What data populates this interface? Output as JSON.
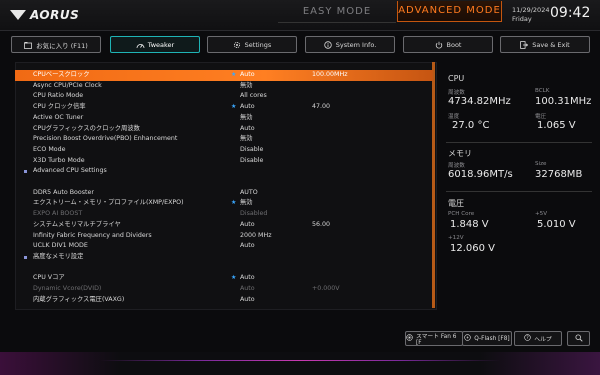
{
  "header": {
    "logo": "AORUS",
    "mode_easy": "EASY MODE",
    "mode_advanced": "ADVANCED MODE",
    "date": "11/29/2024",
    "weekday": "Friday",
    "time": "09:42"
  },
  "tabs": [
    {
      "label": "お気に入り (F11)",
      "icon": "folder-icon"
    },
    {
      "label": "Tweaker",
      "icon": "speedometer-icon"
    },
    {
      "label": "Settings",
      "icon": "gear-icon"
    },
    {
      "label": "System Info.",
      "icon": "info-icon"
    },
    {
      "label": "Boot",
      "icon": "power-icon"
    },
    {
      "label": "Save & Exit",
      "icon": "exit-icon"
    }
  ],
  "rows": [
    {
      "label": "CPUベースクロック",
      "value": "Auto",
      "value2": "100.00MHz",
      "star": true,
      "highlight": true
    },
    {
      "label": "Async CPU/PCIe Clock",
      "value": "無効"
    },
    {
      "label": "CPU Ratio Mode",
      "value": "All cores"
    },
    {
      "label": "CPU クロック倍率",
      "value": "Auto",
      "value2": "47.00",
      "star": true
    },
    {
      "label": "Active OC Tuner",
      "value": "無効"
    },
    {
      "label": "CPUグラフィックスのクロック周波数",
      "value": "Auto"
    },
    {
      "label": "Precision Boost Overdrive(PBO) Enhancement",
      "value": "無効"
    },
    {
      "label": "ECO Mode",
      "value": "Disable"
    },
    {
      "label": "X3D Turbo Mode",
      "value": "Disable"
    },
    {
      "label": "Advanced CPU Settings",
      "bullet": true
    },
    {
      "label": ""
    },
    {
      "label": "DDR5 Auto Booster",
      "value": "AUTO"
    },
    {
      "label": "エクストリーム・メモリ・プロファイル(XMP/EXPO)",
      "value": "無効",
      "star": true
    },
    {
      "label": "EXPO AI BOOST",
      "value": "Disabled",
      "dim": true
    },
    {
      "label": "システムメモリマルチプライヤ",
      "value": "Auto",
      "value2": "56.00"
    },
    {
      "label": "Infinity Fabric Frequency and Dividers",
      "value": "2000 MHz"
    },
    {
      "label": "UCLK DIV1 MODE",
      "value": "Auto"
    },
    {
      "label": "高度なメモリ設定",
      "bullet": true
    },
    {
      "label": ""
    },
    {
      "label": "CPU Vコア",
      "value": "Auto",
      "star": true
    },
    {
      "label": "Dynamic Vcore(DVID)",
      "value": "Auto",
      "value2": "+0.000V",
      "dim": true
    },
    {
      "label": "内蔵グラフィックス電圧(VAXG)",
      "value": "Auto"
    }
  ],
  "side": {
    "cpu_title": "CPU",
    "cpu_freq_cap": "周波数",
    "cpu_freq": "4734.82MHz",
    "bclk_cap": "BCLK",
    "bclk": "100.31MHz",
    "temp_cap": "温度",
    "temp": "27.0 °C",
    "volt_cap": "電圧",
    "volt": "1.065 V",
    "mem_title": "メモリ",
    "mem_freq_cap": "周波数",
    "mem_freq": "6018.96MT/s",
    "size_cap": "Size",
    "size": "32768MB",
    "pw_title": "電圧",
    "pch_cap": "PCH Core",
    "pch": "1.848 V",
    "p5_cap": "+5V",
    "p5": "5.010 V",
    "p12_cap": "+12V",
    "p12": "12.060 V"
  },
  "bottom": {
    "fan": "スマート Fan 6 [F",
    "qflash": "Q-Flash [F8]",
    "help": "ヘルプ"
  },
  "colors": {
    "accent": "#ff7a1f",
    "tab_active": "#1fb3b5",
    "star": "#3aa8ff"
  }
}
